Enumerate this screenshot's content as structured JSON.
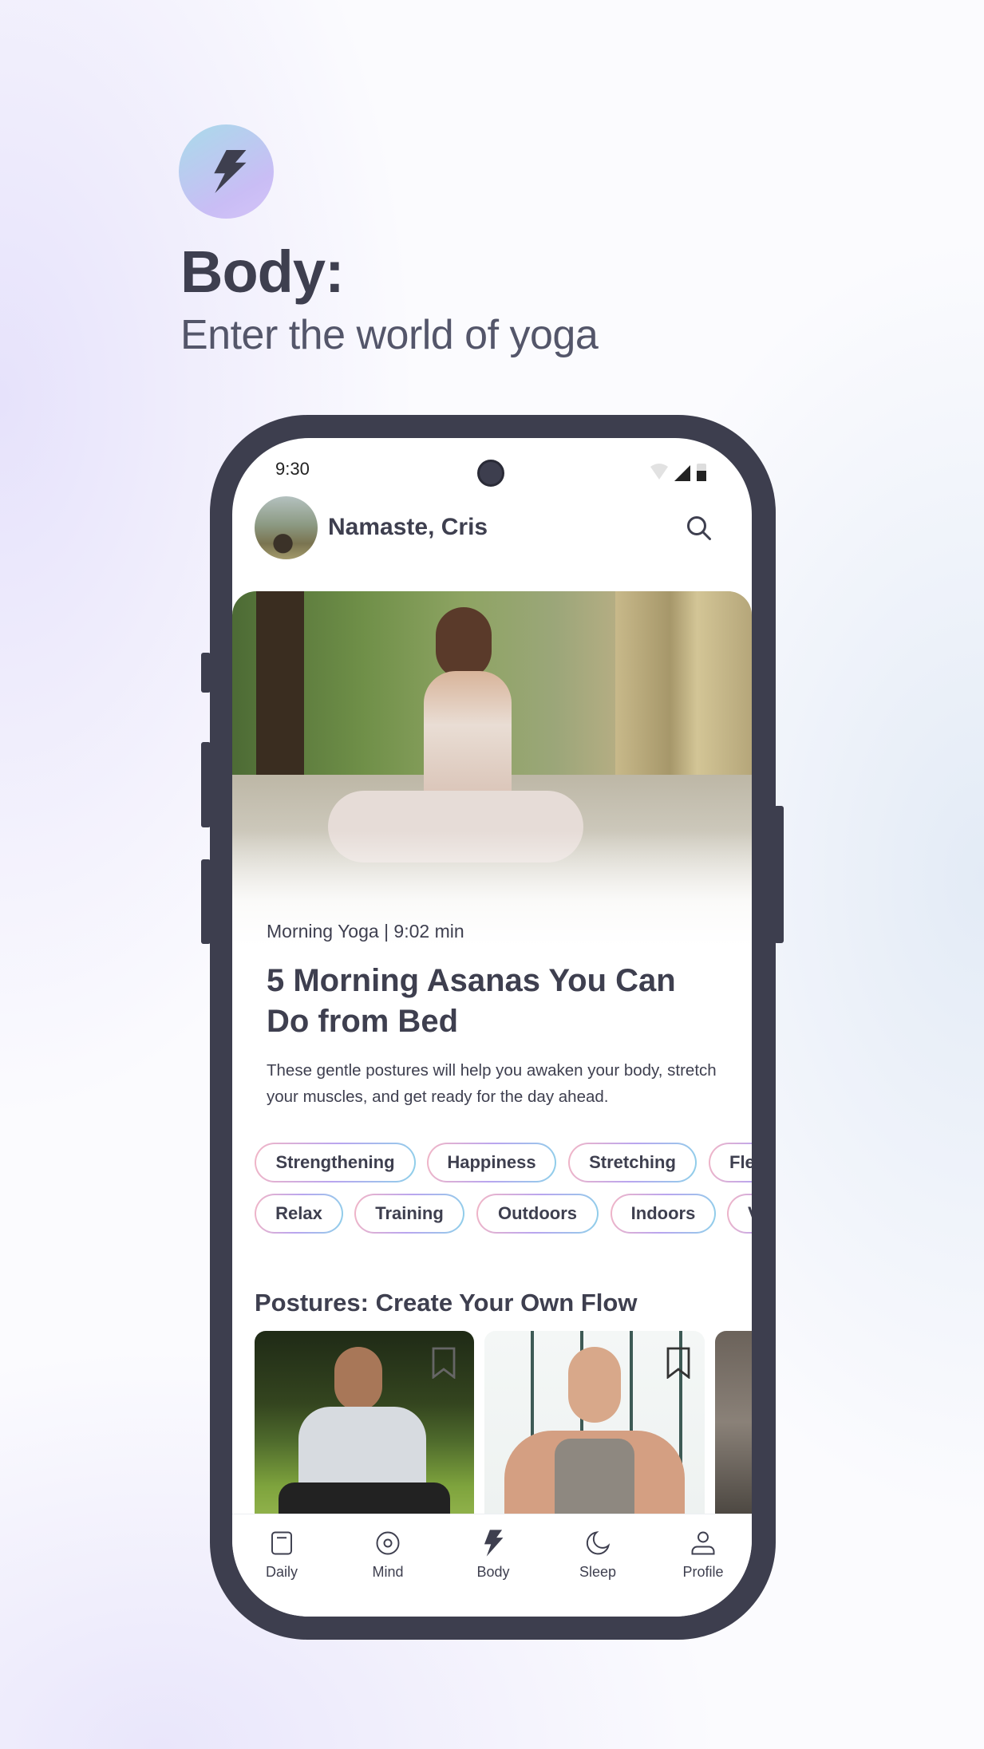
{
  "intro": {
    "icon": "lightning-bolt-icon",
    "title": "Body:",
    "subtitle": "Enter the world of yoga"
  },
  "status_bar": {
    "time": "9:30",
    "icons": [
      "wifi-icon",
      "signal-icon",
      "battery-icon"
    ]
  },
  "header": {
    "greeting": "Namaste, Cris",
    "search_icon": "search-icon"
  },
  "featured": {
    "meta": "Morning Yoga | 9:02 min",
    "title": "5 Morning Asanas You Can Do from Bed",
    "description": "These gentle postures will help you awaken your body, stretch your muscles, and get ready for the day ahead."
  },
  "tags_row1": [
    "Strengthening",
    "Happiness",
    "Stretching",
    "Fle"
  ],
  "tags_row2": [
    "Relax",
    "Training",
    "Outdoors",
    "Indoors",
    "V"
  ],
  "postures": {
    "title": "Postures: Create Your Own Flow"
  },
  "nav": [
    {
      "label": "Daily",
      "icon": "calendar-icon"
    },
    {
      "label": "Mind",
      "icon": "target-icon"
    },
    {
      "label": "Body",
      "icon": "lightning-bolt-icon",
      "active": true
    },
    {
      "label": "Sleep",
      "icon": "moon-icon"
    },
    {
      "label": "Profile",
      "icon": "person-icon"
    }
  ],
  "colors": {
    "text": "#3e3f4f",
    "phone_frame": "#3d3e4e",
    "accent_gradient": [
      "#a9dbea",
      "#c9bdf5"
    ]
  }
}
